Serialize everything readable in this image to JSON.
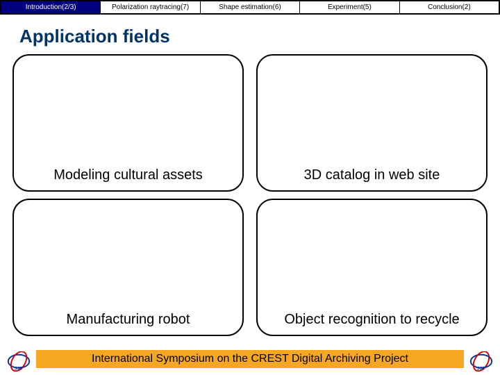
{
  "tabs": {
    "t0": "Introduction(2/3)",
    "t1": "Polarization raytracing(7)",
    "t2": "Shape estimation(6)",
    "t3": "Experiment(5)",
    "t4": "Conclusion(2)"
  },
  "title": "Application fields",
  "cards": {
    "c0": "Modeling cultural assets",
    "c1": "3D catalog in web site",
    "c2": "Manufacturing robot",
    "c3": "Object recognition to recycle"
  },
  "footer": "International Symposium on the CREST Digital Archiving Project"
}
